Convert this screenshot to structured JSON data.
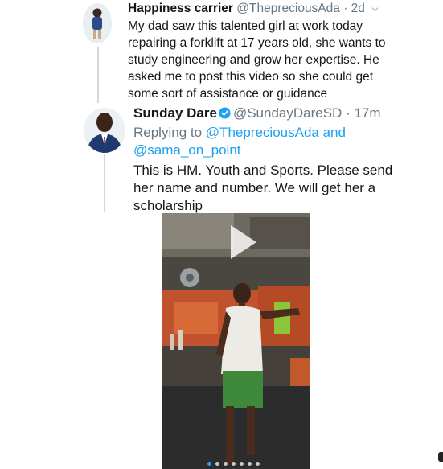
{
  "tweet1": {
    "name": "Happiness carrier",
    "handle": "@ThepreciousAda",
    "time": "· 2d",
    "text": "My dad saw this talented girl at work today repairing a forklift at 17 years old, she wants to study engineering and grow her expertise. He asked me to post this video so she could get some sort of assistance or guidance",
    "menu_icon": "chevron-down-icon"
  },
  "tweet2": {
    "name": "Sunday Dare",
    "verified_icon": "verified-badge-icon",
    "handle": "@SundayDareSD",
    "time": "· 17m",
    "replying_prefix": "Replying to",
    "mention1": "@ThepreciousAda",
    "and_word": "and",
    "mention2": "@sama_on_point",
    "text": "This is HM. Youth and Sports. Please send her name and number. We will get her a scholarship"
  },
  "video": {
    "play_icon": "play-icon",
    "carousel_count": 7,
    "carousel_active": 1
  },
  "colors": {
    "link": "#1da1f2",
    "secondary_text": "#657786",
    "verified": "#1da1f2",
    "carousel_active": "#3897f0"
  }
}
